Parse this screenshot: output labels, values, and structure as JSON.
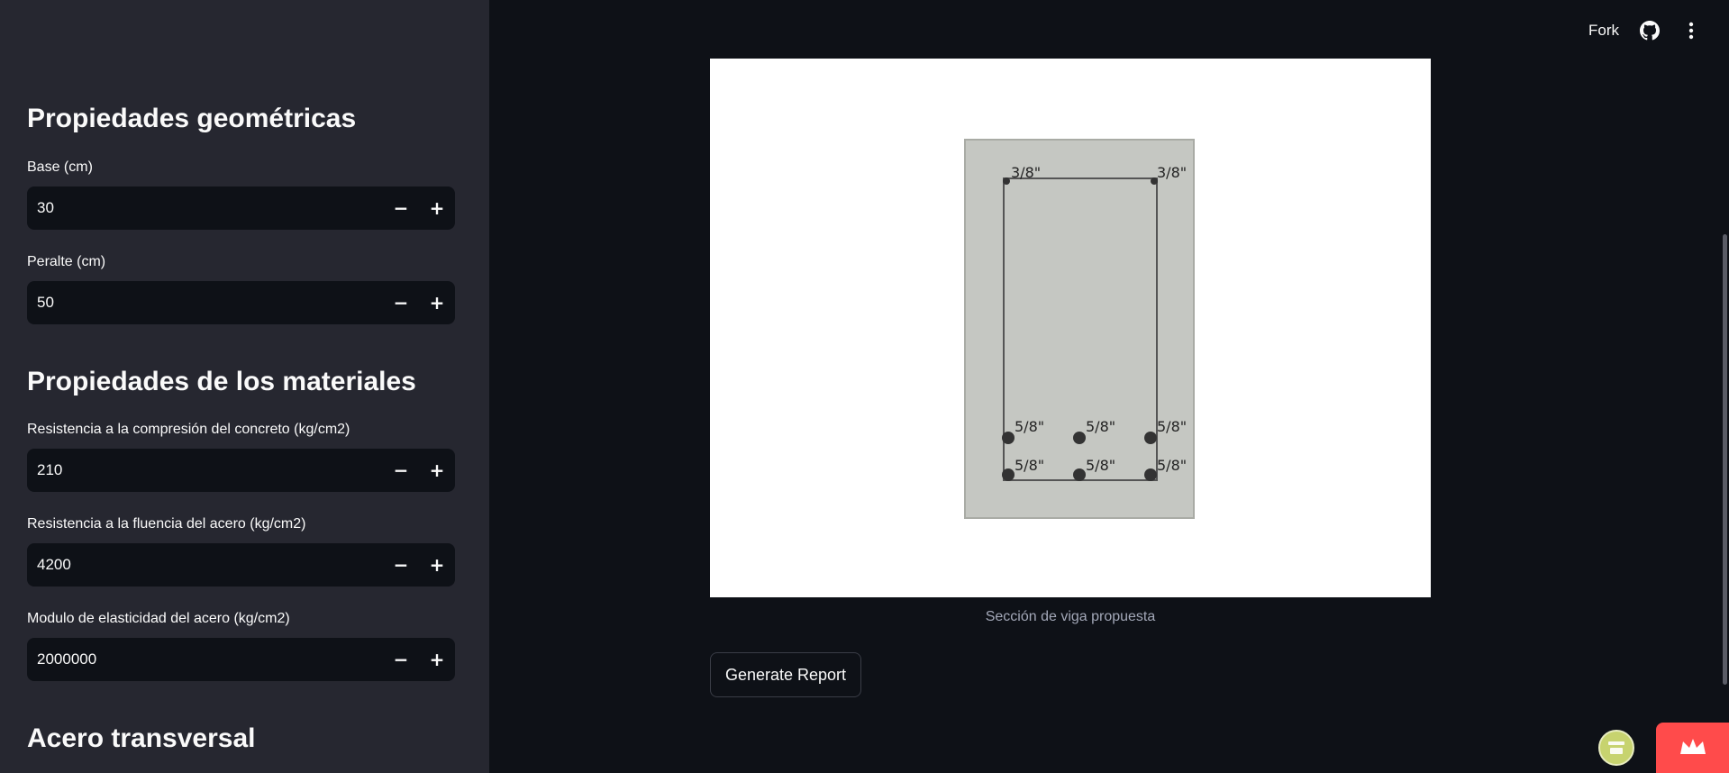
{
  "sidebar": {
    "section_geometry": "Propiedades geométricas",
    "section_materials": "Propiedades de los materiales",
    "section_transverse": "Acero transversal",
    "fields": [
      {
        "label": "Base (cm)",
        "value": "30"
      },
      {
        "label": "Peralte (cm)",
        "value": "50"
      },
      {
        "label": "Resistencia a la compresión del concreto (kg/cm2)",
        "value": "210"
      },
      {
        "label": "Resistencia a la fluencia del acero (kg/cm2)",
        "value": "4200"
      },
      {
        "label": "Modulo de elasticidad del acero (kg/cm2)",
        "value": "2000000"
      }
    ],
    "minus_symbol": "−",
    "plus_symbol": "+"
  },
  "header": {
    "fork_label": "Fork",
    "github_icon": "github-icon",
    "menu_icon": "kebab-menu-icon"
  },
  "figure": {
    "caption": "Sección de viga propuesta",
    "top_bar_labels": [
      "3/8\"",
      "3/8\""
    ],
    "bottom_row1_labels": [
      "5/8\"",
      "5/8\"",
      "5/8\""
    ],
    "bottom_row2_labels": [
      "5/8\"",
      "5/8\"",
      "5/8\""
    ],
    "concrete_color": "#c5c7c2",
    "steel_color": "#333333"
  },
  "actions": {
    "generate_report": "Generate Report"
  },
  "colors": {
    "app_bg": "#0e1117",
    "sidebar_bg": "#262730",
    "deploy_badge": "#ff4b4b"
  }
}
